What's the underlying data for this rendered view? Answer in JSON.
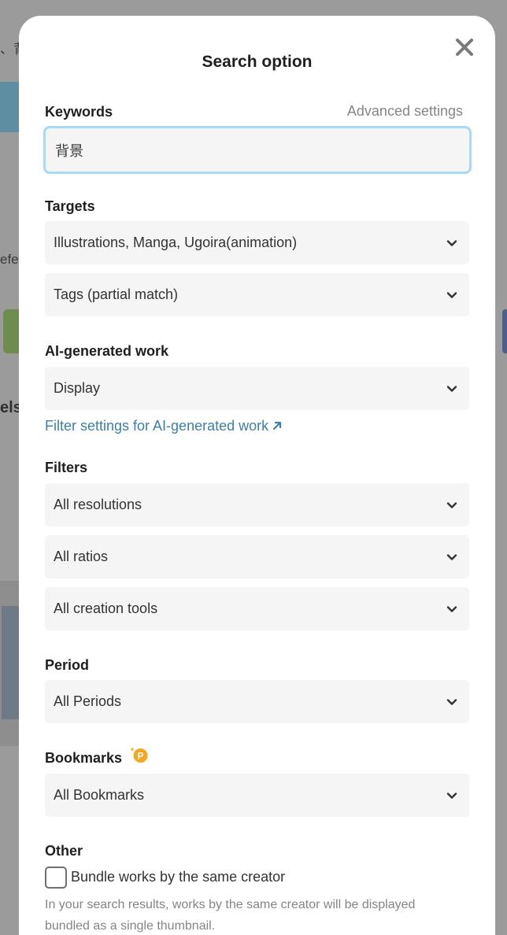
{
  "background": {
    "search_fragment": "、背",
    "text_fragment": "efe",
    "heading_fragment": "els"
  },
  "modal": {
    "title": "Search option",
    "close_icon": "close-x-icon"
  },
  "keywords": {
    "label": "Keywords",
    "advanced_link": "Advanced settings",
    "value": "背景"
  },
  "targets": {
    "label": "Targets",
    "type_select": "Illustrations, Manga, Ugoira(animation)",
    "match_select": "Tags (partial match)"
  },
  "ai_generated": {
    "label": "AI-generated work",
    "select": "Display",
    "filter_link": "Filter settings for AI-generated work",
    "filter_link_icon": "external-arrow-icon"
  },
  "filters": {
    "label": "Filters",
    "resolution_select": "All resolutions",
    "ratio_select": "All ratios",
    "tools_select": "All creation tools"
  },
  "period": {
    "label": "Period",
    "select": "All Periods"
  },
  "bookmarks": {
    "label": "Bookmarks",
    "premium_badge_icon": "premium-p-icon",
    "premium_badge_text": "P",
    "select": "All Bookmarks"
  },
  "other": {
    "label": "Other",
    "checkbox_label": "Bundle works by the same creator",
    "checked": false,
    "help_text": "In your search results, works by the same creator will be displayed bundled as a single thumbnail."
  },
  "colors": {
    "accent_link": "#3c7fa8",
    "input_focus_border": "#a6dbf6",
    "premium_badge": "#f5a623",
    "field_background": "#f5f5f5"
  }
}
